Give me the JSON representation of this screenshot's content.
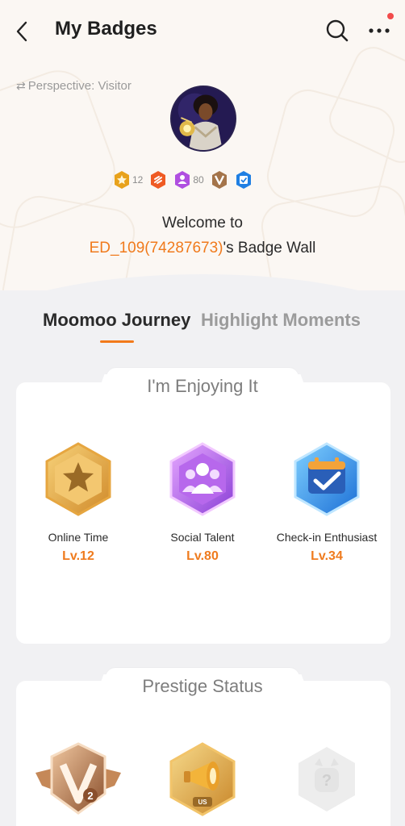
{
  "header": {
    "title": "My Badges"
  },
  "profile": {
    "perspective_label": "Perspective: Visitor",
    "badge_strip": [
      {
        "icon": "star-hex-badge-icon",
        "count": "12",
        "color": "#e8a21c"
      },
      {
        "icon": "fire-hex-badge-icon",
        "count": "",
        "color": "#ef5a23"
      },
      {
        "icon": "group-hex-badge-icon",
        "count": "80",
        "color": "#b04fe0"
      },
      {
        "icon": "v2-shield-badge-icon",
        "count": "",
        "color": "#a4744a"
      },
      {
        "icon": "checkin-hex-badge-icon",
        "count": "",
        "color": "#1f7fe3"
      }
    ],
    "welcome_line1": "Welcome to",
    "username": "ED_109(74287673)",
    "welcome_suffix": "'s Badge Wall"
  },
  "tabs": {
    "active": "Moomoo Journey",
    "inactive": "Highlight Moments"
  },
  "sections": [
    {
      "title": "I'm Enjoying It",
      "badges": [
        {
          "name": "Online Time",
          "level": "Lv.12",
          "icon": "star-hex-icon"
        },
        {
          "name": "Social Talent",
          "level": "Lv.80",
          "icon": "people-hex-icon"
        },
        {
          "name": "Check-in Enthusiast",
          "level": "Lv.34",
          "icon": "calendar-check-hex-icon"
        }
      ]
    },
    {
      "title": "Prestige Status",
      "badges": [
        {
          "name": "",
          "level": "",
          "icon": "v2-winged-shield-icon"
        },
        {
          "name": "",
          "level": "",
          "icon": "megaphone-us-hex-icon"
        },
        {
          "name": "",
          "level": "",
          "icon": "locked-question-hex-icon"
        }
      ]
    }
  ],
  "colors": {
    "accent": "#f07a1c",
    "notification_dot": "#f24b4b"
  }
}
